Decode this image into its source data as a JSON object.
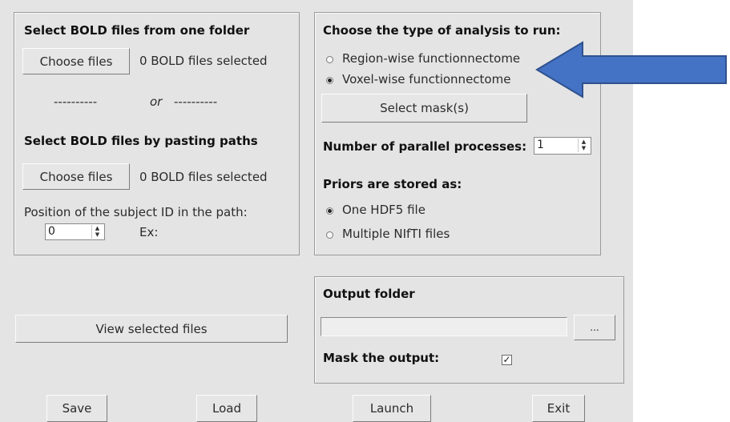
{
  "left_panel": {
    "title": "Select BOLD files from one folder",
    "choose_label": "Choose files",
    "selected_text": "0 BOLD files selected",
    "separator_left": "----------",
    "separator_or": "or",
    "separator_right": "----------",
    "paste_title": "Select BOLD files by pasting paths",
    "choose2_label": "Choose files",
    "selected2_text": "0 BOLD files selected",
    "position_label": "Position of the subject ID in the path:",
    "position_value": "0",
    "example_label": "Ex:"
  },
  "view_button_label": "View selected files",
  "analysis_panel": {
    "title": "Choose the type of analysis to run:",
    "options": [
      "Region-wise functionnectome",
      "Voxel-wise functionnectome"
    ],
    "selected_index": 1,
    "mask_button_label": "Select mask(s)",
    "parallel_label": "Number of parallel processes:",
    "parallel_value": "1",
    "priors_label": "Priors are stored as:",
    "priors_options": [
      "One HDF5 file",
      "Multiple NIfTI files"
    ],
    "priors_selected_index": 0
  },
  "output_panel": {
    "title": "Output folder",
    "path_value": "",
    "browse_label": "...",
    "mask_label": "Mask the output:",
    "mask_checked": true,
    "check_mark": "✓"
  },
  "bottom_buttons": {
    "save": "Save",
    "load": "Load",
    "launch": "Launch",
    "exit": "Exit"
  },
  "annotation": {
    "arrow_color": "#4472c4",
    "arrow_stroke": "#2f528f"
  }
}
